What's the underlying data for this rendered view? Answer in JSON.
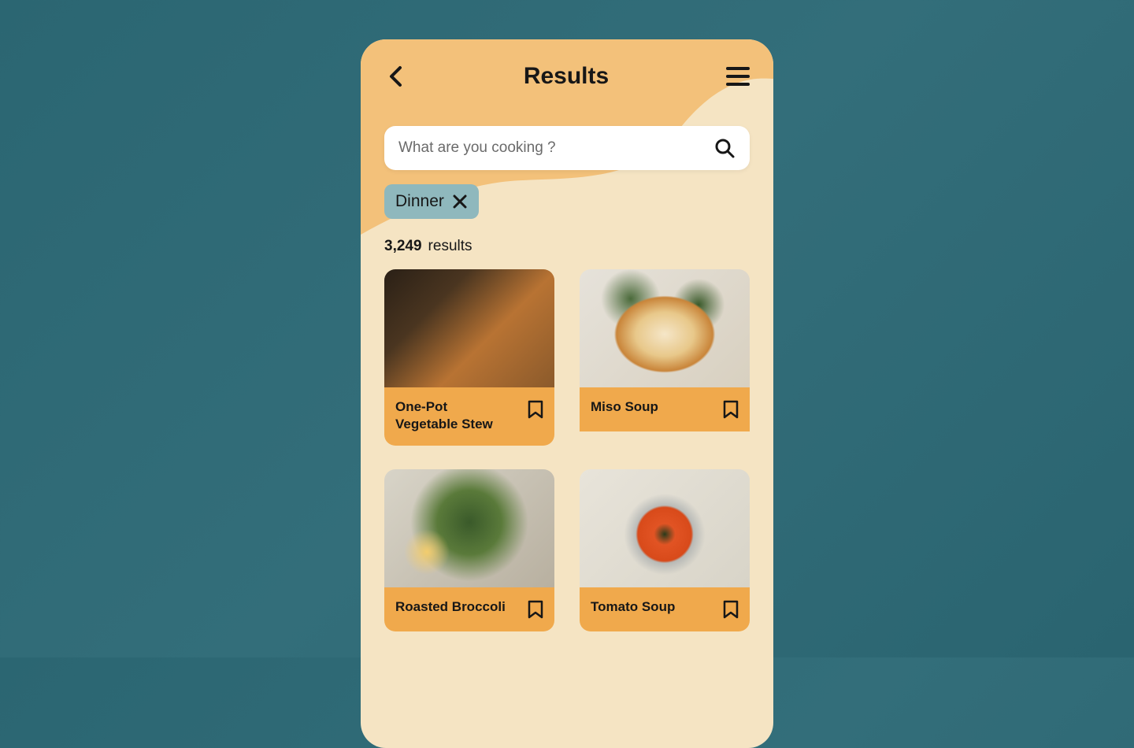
{
  "header": {
    "title": "Results"
  },
  "search": {
    "placeholder": "What are you cooking ?",
    "value": ""
  },
  "filter": {
    "label": "Dinner"
  },
  "results": {
    "count": "3,249",
    "label": "results"
  },
  "cards": [
    {
      "title": "One-Pot Vegetable Stew"
    },
    {
      "title": "Miso Soup"
    },
    {
      "title": "Roasted Broccoli"
    },
    {
      "title": "Tomato Soup"
    }
  ]
}
